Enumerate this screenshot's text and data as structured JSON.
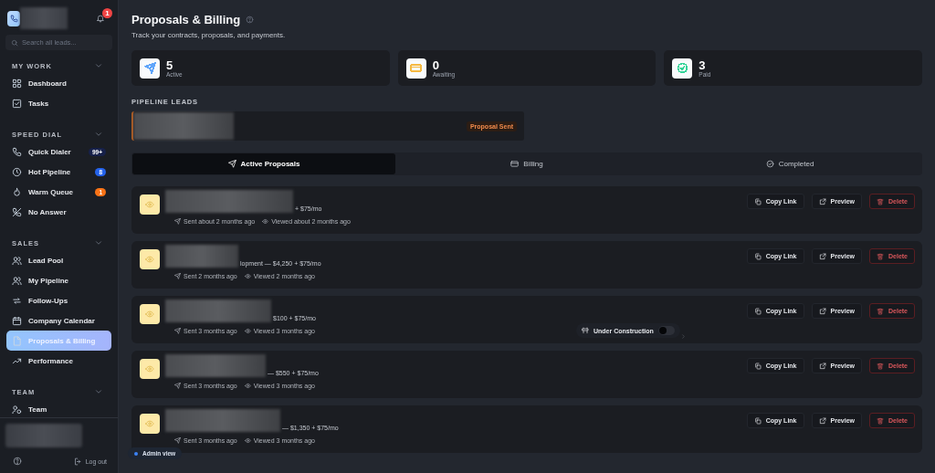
{
  "sidebar": {
    "notifications": "1",
    "search": {
      "placeholder": "Search all leads..."
    },
    "sections": [
      {
        "title": "MY WORK",
        "expanded": true,
        "items": [
          {
            "label": "Dashboard",
            "selected": false
          },
          {
            "label": "Tasks",
            "selected": false
          }
        ]
      },
      {
        "title": "SPEED DIAL",
        "expanded": true,
        "items": [
          {
            "label": "Quick Dialer",
            "selected": false,
            "badge": {
              "text": "99+",
              "color": "#17214a"
            }
          },
          {
            "label": "Hot Pipeline",
            "selected": false,
            "badge": {
              "text": "8",
              "color": "#2563eb"
            }
          },
          {
            "label": "Warm Queue",
            "selected": false,
            "badge": {
              "text": "1",
              "color": "#f97316"
            }
          },
          {
            "label": "No Answer",
            "selected": false
          }
        ]
      },
      {
        "title": "SALES",
        "expanded": true,
        "items": [
          {
            "label": "Lead Pool",
            "selected": false
          },
          {
            "label": "My Pipeline",
            "selected": false
          },
          {
            "label": "Follow-Ups",
            "selected": false
          },
          {
            "label": "Company Calendar",
            "selected": false
          },
          {
            "label": "Proposals & Billing",
            "selected": true
          },
          {
            "label": "Performance",
            "selected": false
          }
        ]
      },
      {
        "title": "TEAM",
        "expanded": true,
        "items": [
          {
            "label": "Team",
            "selected": false
          }
        ]
      }
    ],
    "logout": "Log out"
  },
  "page": {
    "title": "Proposals & Billing",
    "subtitle": "Track your contracts, proposals, and payments."
  },
  "stats": [
    {
      "value": "5",
      "label": "Active",
      "color": "#60a5fa"
    },
    {
      "value": "0",
      "label": "Awaiting",
      "color": "#f5b942"
    },
    {
      "value": "3",
      "label": "Paid",
      "color": "#34d399"
    }
  ],
  "pipeline_leads": {
    "title": "PIPELINE LEADS",
    "leads": [
      {
        "status": "Proposal Sent"
      }
    ]
  },
  "tabs": [
    {
      "label": "Active Proposals",
      "selected": true
    },
    {
      "label": "Billing",
      "selected": false
    },
    {
      "label": "Completed",
      "selected": false
    }
  ],
  "proposals": [
    {
      "summary": "+ $75/mo",
      "sent": "Sent about 2 months ago",
      "viewed": "Viewed about 2 months ago",
      "actions": [
        "Copy Link",
        "Preview",
        "Delete"
      ]
    },
    {
      "summary": "lopment — $4,250 + $75/mo",
      "sent": "Sent 2 months ago",
      "viewed": "Viewed 2 months ago",
      "actions": [
        "Copy Link",
        "Preview",
        "Delete"
      ]
    },
    {
      "summary": "$100 + $75/mo",
      "sent": "Sent 3 months ago",
      "viewed": "Viewed 3 months ago",
      "actions": [
        "Copy Link",
        "Preview",
        "Delete"
      ]
    },
    {
      "summary": "— $550 + $75/mo",
      "sent": "Sent 3 months ago",
      "viewed": "Viewed 3 months ago",
      "actions": [
        "Copy Link",
        "Preview",
        "Delete"
      ]
    },
    {
      "summary": "— $1,350 + $75/mo",
      "sent": "Sent 3 months ago",
      "viewed": "Viewed 3 months ago",
      "actions": [
        "Copy Link",
        "Preview",
        "Delete"
      ]
    }
  ],
  "under_construction": {
    "label": "Under Construction",
    "on": false
  },
  "admin_badge": {
    "label": "Admin view"
  }
}
